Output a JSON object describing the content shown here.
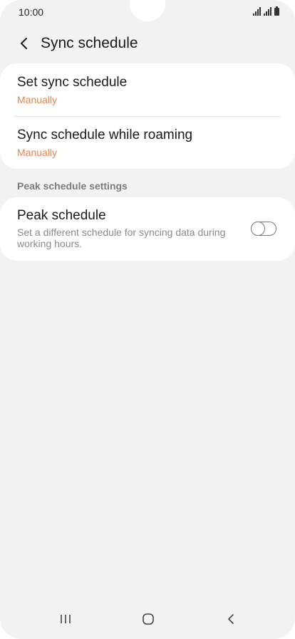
{
  "status_bar": {
    "time": "10:00"
  },
  "header": {
    "title": "Sync schedule",
    "back_icon": "chevron-left-icon"
  },
  "sync_card": {
    "items": [
      {
        "title": "Set sync schedule",
        "value": "Manually"
      },
      {
        "title": "Sync schedule while roaming",
        "value": "Manually"
      }
    ]
  },
  "peak_section": {
    "header": "Peak schedule settings",
    "item": {
      "title": "Peak schedule",
      "description": "Set a different schedule for syncing data during working hours.",
      "toggle_on": false
    }
  },
  "nav_bar": {
    "recents_icon": "recents-icon",
    "home_icon": "home-icon",
    "back_icon": "back-icon"
  },
  "colors": {
    "accent": "#e8844a",
    "background": "#f2f2f2",
    "card": "#ffffff"
  }
}
